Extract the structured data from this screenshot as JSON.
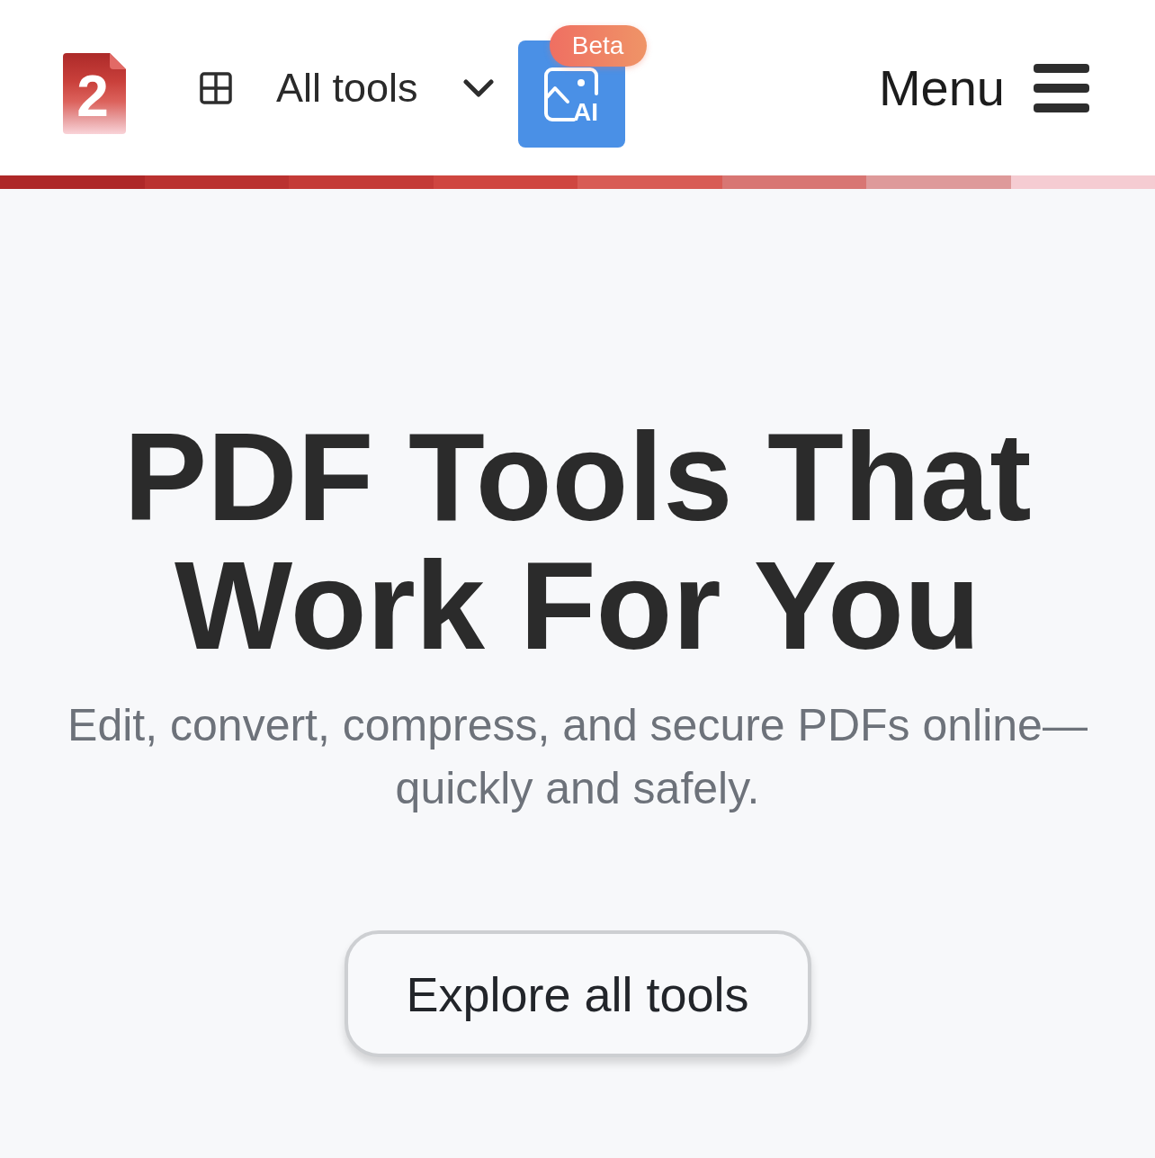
{
  "header": {
    "logo": {
      "glyph": "2"
    },
    "all_tools": {
      "label": "All tools"
    },
    "ai_button": {
      "icon_text": "AI",
      "badge": "Beta"
    },
    "menu": {
      "label": "Menu"
    }
  },
  "hero": {
    "title": "PDF Tools That Work For You",
    "subtitle": "Edit, convert, compress, and secure PDFs online—quickly and safely.",
    "cta": "Explore all tools"
  }
}
